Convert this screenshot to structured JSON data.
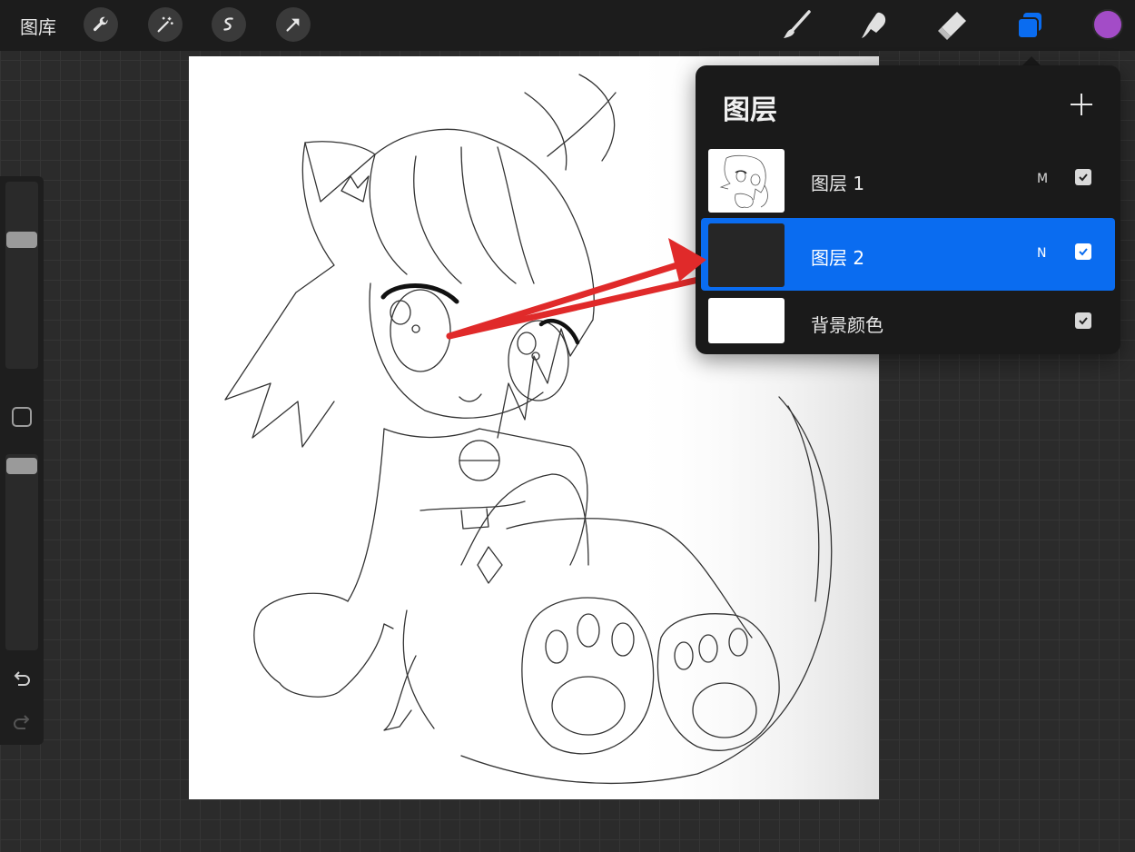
{
  "topbar": {
    "gallery_label": "图库",
    "left_tools": [
      "wrench-icon",
      "magic-wand-icon",
      "selection-icon",
      "transform-arrow-icon"
    ],
    "right_tools": [
      "brush-icon",
      "smudge-icon",
      "eraser-icon",
      "layers-icon"
    ],
    "active_tool": "layers-icon",
    "active_color": "#a34cc7",
    "accent": "#0a6cf0"
  },
  "layers_panel": {
    "title": "图层",
    "layers": [
      {
        "name": "图层 1",
        "mode": "M",
        "visible": true,
        "selected": false
      },
      {
        "name": "图层 2",
        "mode": "N",
        "visible": true,
        "selected": true
      },
      {
        "name": "背景颜色",
        "mode": "",
        "visible": true,
        "selected": false
      }
    ]
  },
  "sidebar": {
    "brush_size_level": 0.71,
    "opacity_level": 0.98
  }
}
